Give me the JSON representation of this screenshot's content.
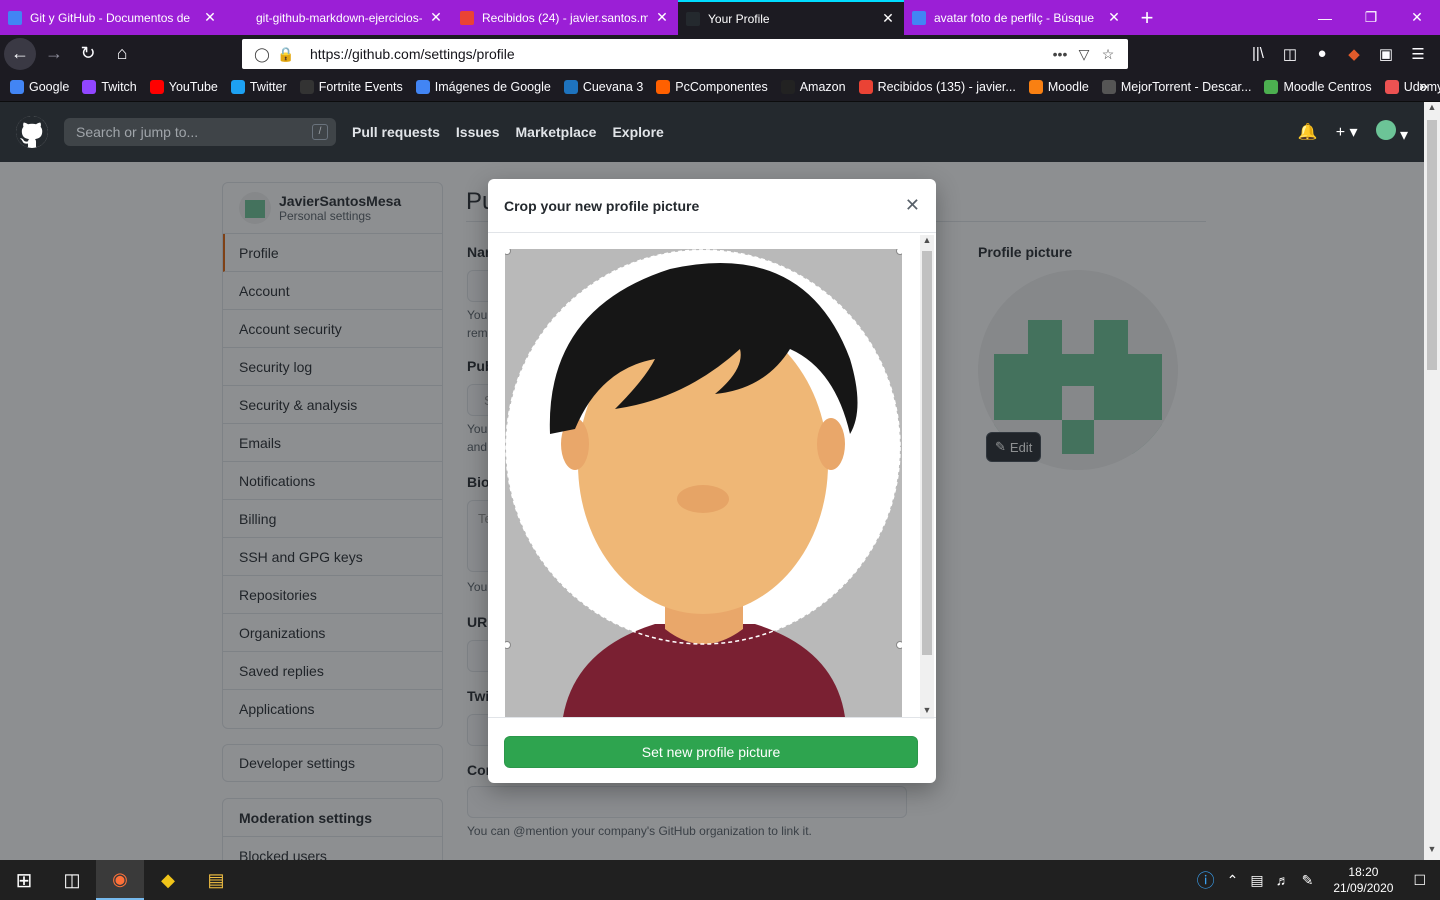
{
  "browser": {
    "tabs": [
      {
        "title": "Git y GitHub - Documentos de",
        "color": "#4285f4"
      },
      {
        "title": "git-github-markdown-ejercicios-0",
        "color": "#9b1fd6"
      },
      {
        "title": "Recibidos (24) - javier.santos.m",
        "color": "#ea4335"
      },
      {
        "title": "Your Profile",
        "color": "#24292e"
      },
      {
        "title": "avatar foto de perfilç - Búsque",
        "color": "#4285f4"
      }
    ],
    "url": "https://github.com/settings/profile",
    "bookmarks": [
      {
        "label": "Google",
        "color": "#4285f4"
      },
      {
        "label": "Twitch",
        "color": "#9146ff"
      },
      {
        "label": "YouTube",
        "color": "#ff0000"
      },
      {
        "label": "Twitter",
        "color": "#1da1f2"
      },
      {
        "label": "Fortnite Events",
        "color": "#333333"
      },
      {
        "label": "Imágenes de Google",
        "color": "#4285f4"
      },
      {
        "label": "Cuevana 3",
        "color": "#1e73be"
      },
      {
        "label": "PcComponentes",
        "color": "#ff6000"
      },
      {
        "label": "Amazon",
        "color": "#222222"
      },
      {
        "label": "Recibidos (135) - javier...",
        "color": "#ea4335"
      },
      {
        "label": "Moodle",
        "color": "#f98012"
      },
      {
        "label": "MejorTorrent - Descar...",
        "color": "#555555"
      },
      {
        "label": "Moodle Centros",
        "color": "#4caf50"
      },
      {
        "label": "Udemy",
        "color": "#ec5252"
      }
    ]
  },
  "github": {
    "search_placeholder": "Search or jump to...",
    "search_key": "/",
    "nav": [
      "Pull requests",
      "Issues",
      "Marketplace",
      "Explore"
    ]
  },
  "sidebar": {
    "username": "JavierSantosMesa",
    "subtitle": "Personal settings",
    "items": [
      "Profile",
      "Account",
      "Account security",
      "Security log",
      "Security & analysis",
      "Emails",
      "Notifications",
      "Billing",
      "SSH and GPG keys",
      "Repositories",
      "Organizations",
      "Saved replies",
      "Applications"
    ],
    "developer": "Developer settings",
    "moderation": "Moderation settings",
    "moderation_item": "Blocked users"
  },
  "main": {
    "title": "Pu",
    "labels": [
      "Nar",
      "Pub",
      "Bio",
      "URL",
      "Twi",
      "Cor"
    ],
    "notes": [
      "You",
      "rem",
      "You",
      "and",
      "You"
    ],
    "bio_placeholder": "Te",
    "public_placeholder": "S",
    "company_note": "You can @mention your company's GitHub organization to link it."
  },
  "profile_picture": {
    "label": "Profile picture",
    "edit": "Edit"
  },
  "modal": {
    "title": "Crop your new profile picture",
    "button": "Set new profile picture",
    "accent": "#2ea44f"
  },
  "taskbar": {
    "time": "18:20",
    "date": "21/09/2020"
  }
}
